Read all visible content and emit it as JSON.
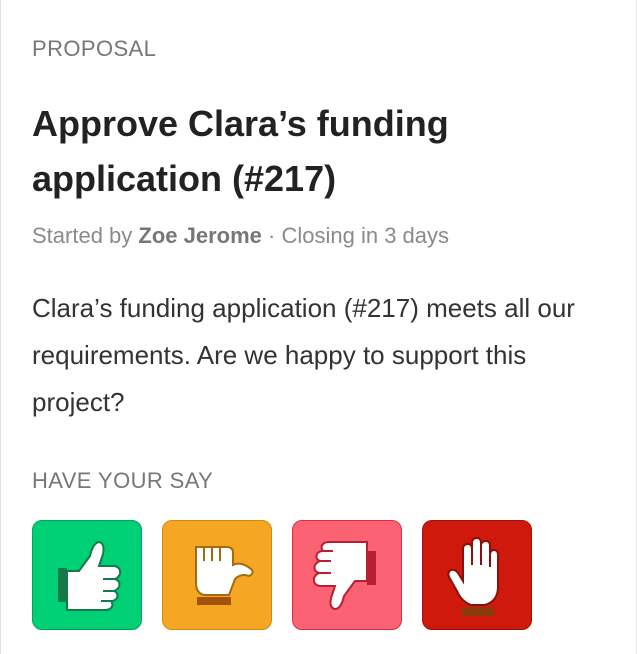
{
  "proposal": {
    "eyebrow": "PROPOSAL",
    "title": "Approve Clara’s funding application (#217)",
    "meta": {
      "started_by_prefix": "Started by",
      "author": "Zoe Jerome",
      "separator": "·",
      "closing": "Closing in 3 days"
    },
    "description": "Clara’s funding application (#217) meets all our requirements. Are we happy to support this project?"
  },
  "vote": {
    "section_label": "HAVE YOUR SAY",
    "options": [
      {
        "name": "agree",
        "icon": "thumbs-up-icon",
        "color": "#00d075"
      },
      {
        "name": "abstain",
        "icon": "thumbs-side-icon",
        "color": "#f5a623"
      },
      {
        "name": "disagree",
        "icon": "thumbs-down-icon",
        "color": "#fb6374"
      },
      {
        "name": "block",
        "icon": "raised-hand-icon",
        "color": "#d0190d"
      }
    ]
  }
}
